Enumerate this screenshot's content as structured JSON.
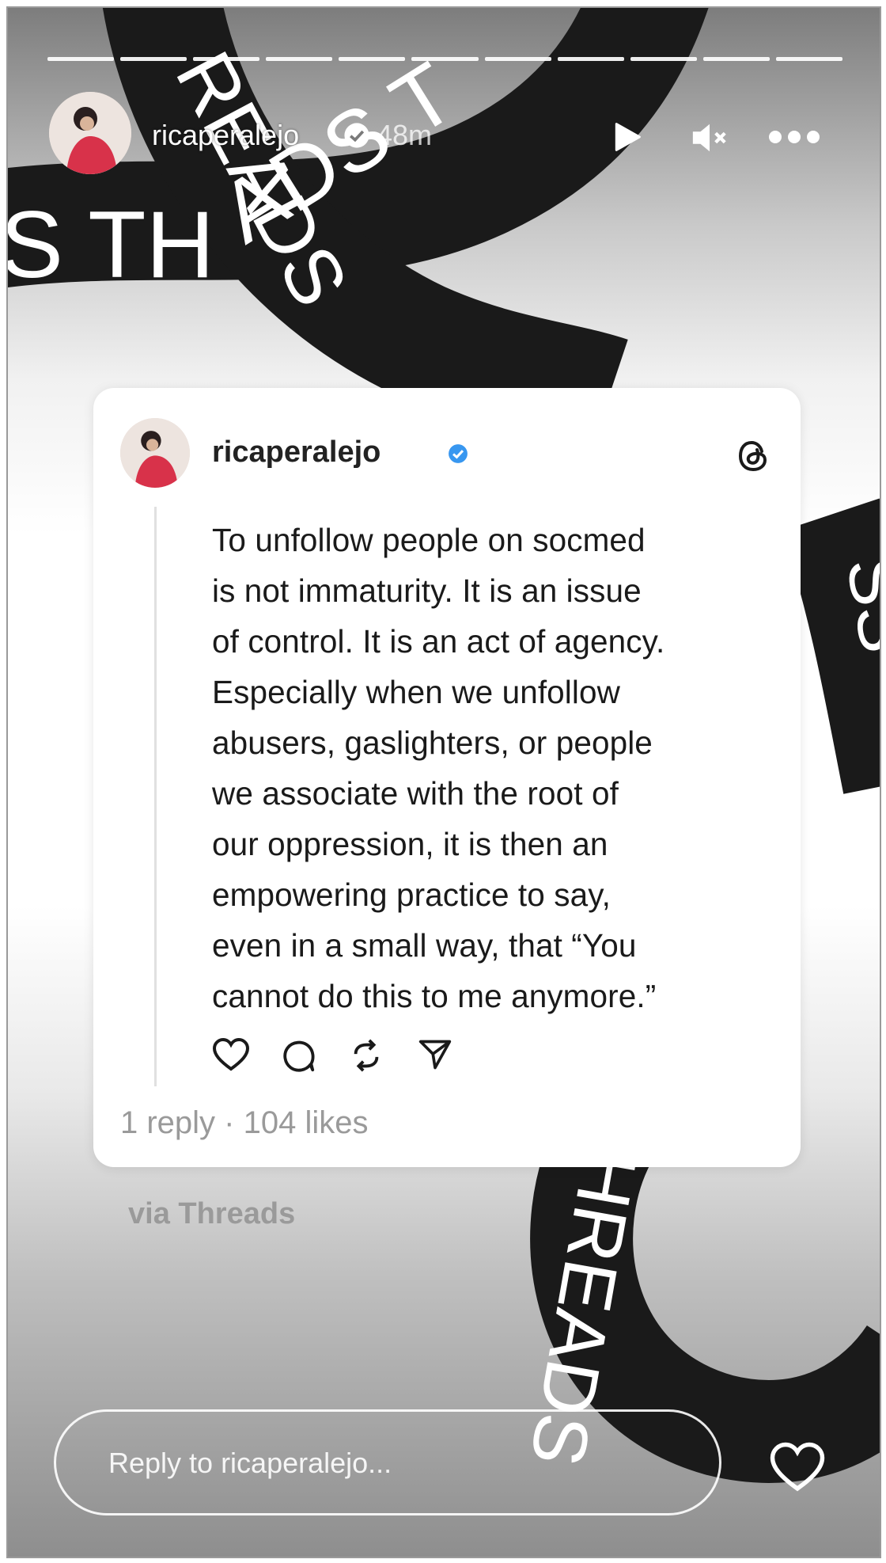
{
  "story": {
    "segments": 11,
    "username": "ricaperalejo",
    "time": "48m",
    "icons": [
      "play-icon",
      "mute-icon",
      "more-icon"
    ]
  },
  "background": {
    "ribbon_word": "THREADS",
    "ribbon_top": "S TH",
    "ribbon_diag": "READS",
    "ribbon_arc": "ADS T",
    "ribbon_right": "SS",
    "ribbon_bottom": "HREADS",
    "ribbon_bottom_r": "HR"
  },
  "post": {
    "username": "ricaperalejo",
    "lines": [
      "To unfollow people on socmed",
      "is not immaturity. It is an issue",
      "of control. It is an act of agency.",
      "Especially when we unfollow",
      "abusers, gaslighters, or people",
      "we associate with the root of",
      "our oppression, it is then an",
      "empowering practice to say,",
      "even in a small way, that “You",
      "cannot do this to me anymore.”"
    ],
    "stats": "1 reply · 104 likes",
    "action_icons": [
      "heart-icon",
      "comment-icon",
      "repost-icon",
      "share-icon"
    ]
  },
  "via": "via Threads",
  "reply": {
    "placeholder": "Reply to ricaperalejo..."
  },
  "colors": {
    "verified": "#3897f0",
    "ribbon": "#1a1a1a",
    "avatar_dress": "#d8324a"
  }
}
